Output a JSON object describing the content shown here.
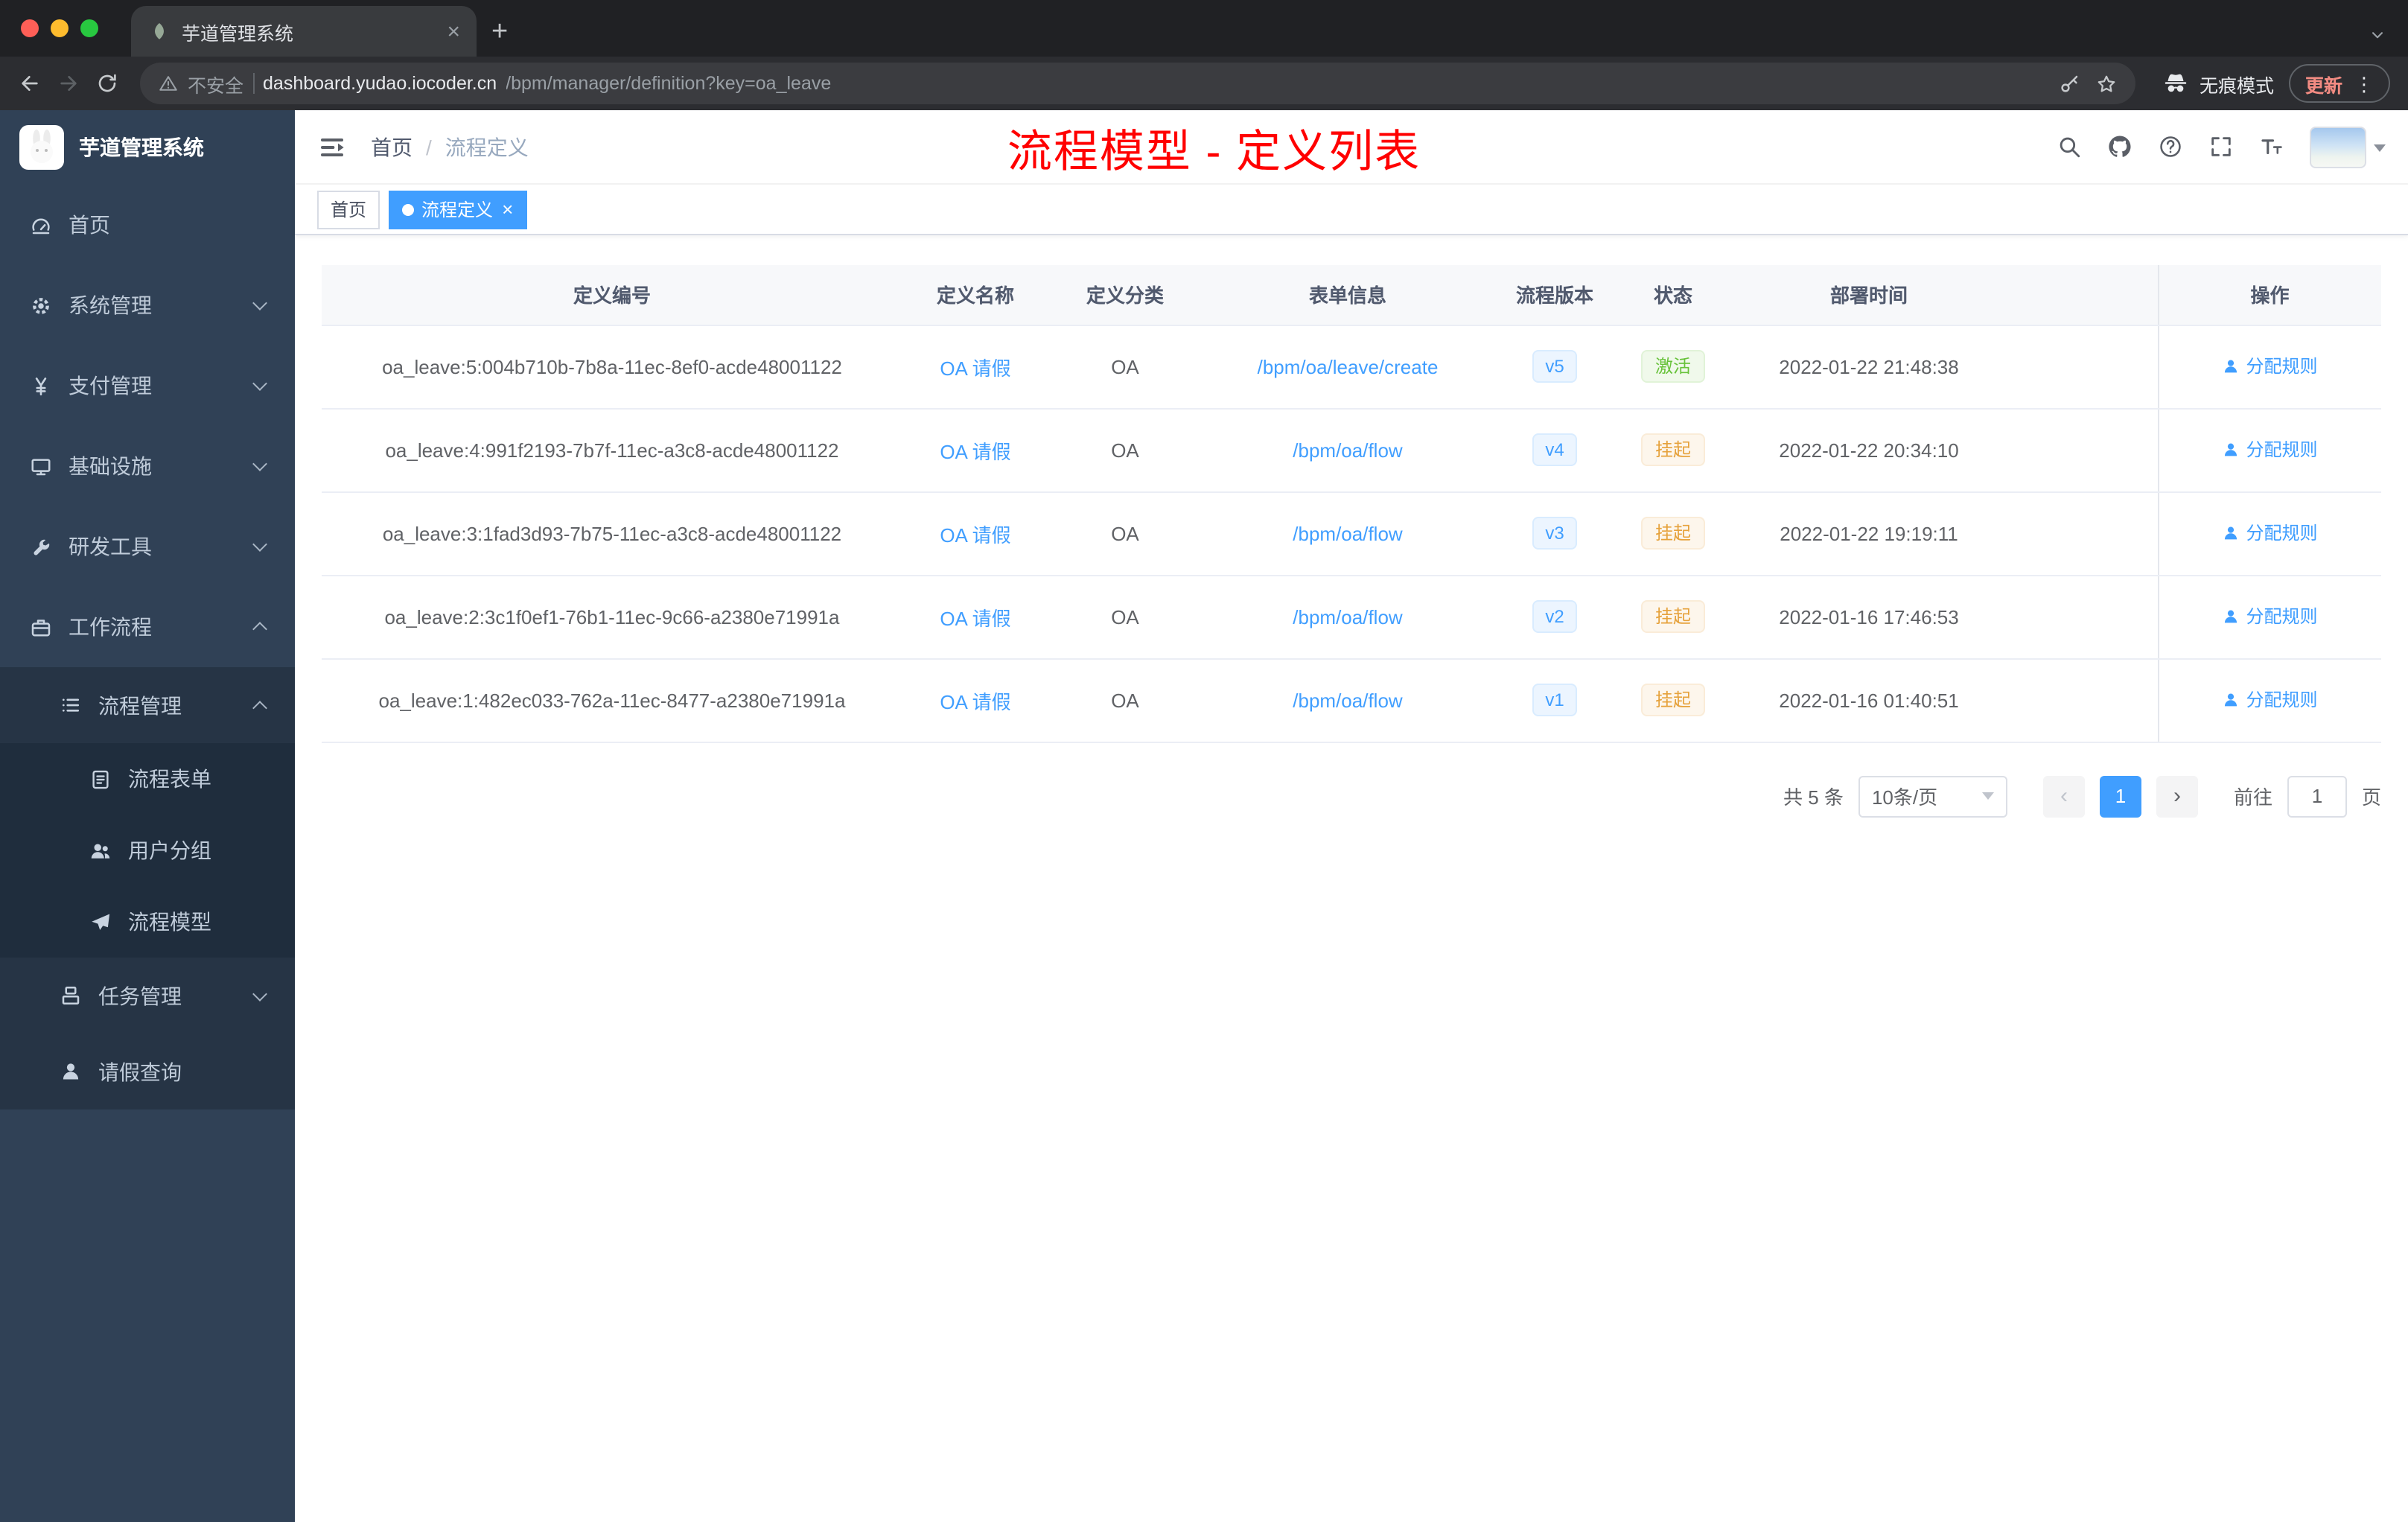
{
  "colors": {
    "accent": "#409eff",
    "success": "#67c23a",
    "warning": "#e6a23c",
    "annotation": "#ff0000",
    "sidebar": "#304156",
    "sidebar-sub": "#1f2d3d",
    "sidebar-text": "#bfcbd9"
  },
  "icons": {
    "close": "×",
    "plus": "+",
    "more": "⋮",
    "prev": "‹",
    "next": "›"
  },
  "browser": {
    "traffic_lights": [
      "#ff5f57",
      "#febc2e",
      "#28c840"
    ],
    "tab_title": "芋道管理系统",
    "security_label": "不安全",
    "url_domain": "dashboard.yudao.iocoder.cn",
    "url_path": "/bpm/manager/definition?key=oa_leave",
    "incognito_label": "无痕模式",
    "update_label": "更新"
  },
  "sidebar": {
    "logo_title": "芋道管理系统",
    "menu": [
      {
        "key": "home",
        "label": "首页",
        "icon": "dashboard-icon",
        "level": 1
      },
      {
        "key": "system-management",
        "label": "系统管理",
        "icon": "gear-icon",
        "level": 1,
        "arrow": "down"
      },
      {
        "key": "payment-management",
        "label": "支付管理",
        "icon": "yen-icon",
        "level": 1,
        "arrow": "down"
      },
      {
        "key": "infrastructure",
        "label": "基础设施",
        "icon": "monitor-icon",
        "level": 1,
        "arrow": "down"
      },
      {
        "key": "dev-tools",
        "label": "研发工具",
        "icon": "wrench-icon",
        "level": 1,
        "arrow": "down"
      },
      {
        "key": "workflow",
        "label": "工作流程",
        "icon": "briefcase-icon",
        "level": 1,
        "arrow": "up"
      },
      {
        "key": "process-management",
        "label": "流程管理",
        "icon": "list-icon",
        "level": 2,
        "arrow": "up"
      },
      {
        "key": "process-form",
        "label": "流程表单",
        "icon": "form-icon",
        "level": 3
      },
      {
        "key": "user-group",
        "label": "用户分组",
        "icon": "user-group-icon",
        "level": 3
      },
      {
        "key": "process-model",
        "label": "流程模型",
        "icon": "paper-plane-icon",
        "level": 3
      },
      {
        "key": "task-management",
        "label": "任务管理",
        "icon": "task-icon",
        "level": 2,
        "arrow": "down"
      },
      {
        "key": "leave-query",
        "label": "请假查询",
        "icon": "person-icon",
        "level": 2
      }
    ]
  },
  "navbar": {
    "breadcrumb_home": "首页",
    "breadcrumb_separator": "/",
    "breadcrumb_current": "流程定义",
    "annotation": "流程模型 - 定义列表"
  },
  "tags_bar": [
    {
      "label": "首页",
      "active": false,
      "closable": false
    },
    {
      "label": "流程定义",
      "active": true,
      "closable": true
    }
  ],
  "table": {
    "columns": [
      "定义编号",
      "定义名称",
      "定义分类",
      "表单信息",
      "流程版本",
      "状态",
      "部署时间",
      "操作"
    ],
    "rows": [
      {
        "id": "oa_leave:5:004b710b-7b8a-11ec-8ef0-acde48001122",
        "name": "OA 请假",
        "category": "OA",
        "form": "/bpm/oa/leave/create",
        "version": "v5",
        "status": "激活",
        "status_type": "success",
        "deployed_at": "2022-01-22 21:48:38",
        "action": "分配规则"
      },
      {
        "id": "oa_leave:4:991f2193-7b7f-11ec-a3c8-acde48001122",
        "name": "OA 请假",
        "category": "OA",
        "form": "/bpm/oa/flow",
        "version": "v4",
        "status": "挂起",
        "status_type": "warning",
        "deployed_at": "2022-01-22 20:34:10",
        "action": "分配规则"
      },
      {
        "id": "oa_leave:3:1fad3d93-7b75-11ec-a3c8-acde48001122",
        "name": "OA 请假",
        "category": "OA",
        "form": "/bpm/oa/flow",
        "version": "v3",
        "status": "挂起",
        "status_type": "warning",
        "deployed_at": "2022-01-22 19:19:11",
        "action": "分配规则"
      },
      {
        "id": "oa_leave:2:3c1f0ef1-76b1-11ec-9c66-a2380e71991a",
        "name": "OA 请假",
        "category": "OA",
        "form": "/bpm/oa/flow",
        "version": "v2",
        "status": "挂起",
        "status_type": "warning",
        "deployed_at": "2022-01-16 17:46:53",
        "action": "分配规则"
      },
      {
        "id": "oa_leave:1:482ec033-762a-11ec-8477-a2380e71991a",
        "name": "OA 请假",
        "category": "OA",
        "form": "/bpm/oa/flow",
        "version": "v1",
        "status": "挂起",
        "status_type": "warning",
        "deployed_at": "2022-01-16 01:40:51",
        "action": "分配规则"
      }
    ]
  },
  "pagination": {
    "total": "共 5 条",
    "page_size": "10条/页",
    "page": "1",
    "goto": "前往",
    "goto_value": "1",
    "unit": "页"
  }
}
